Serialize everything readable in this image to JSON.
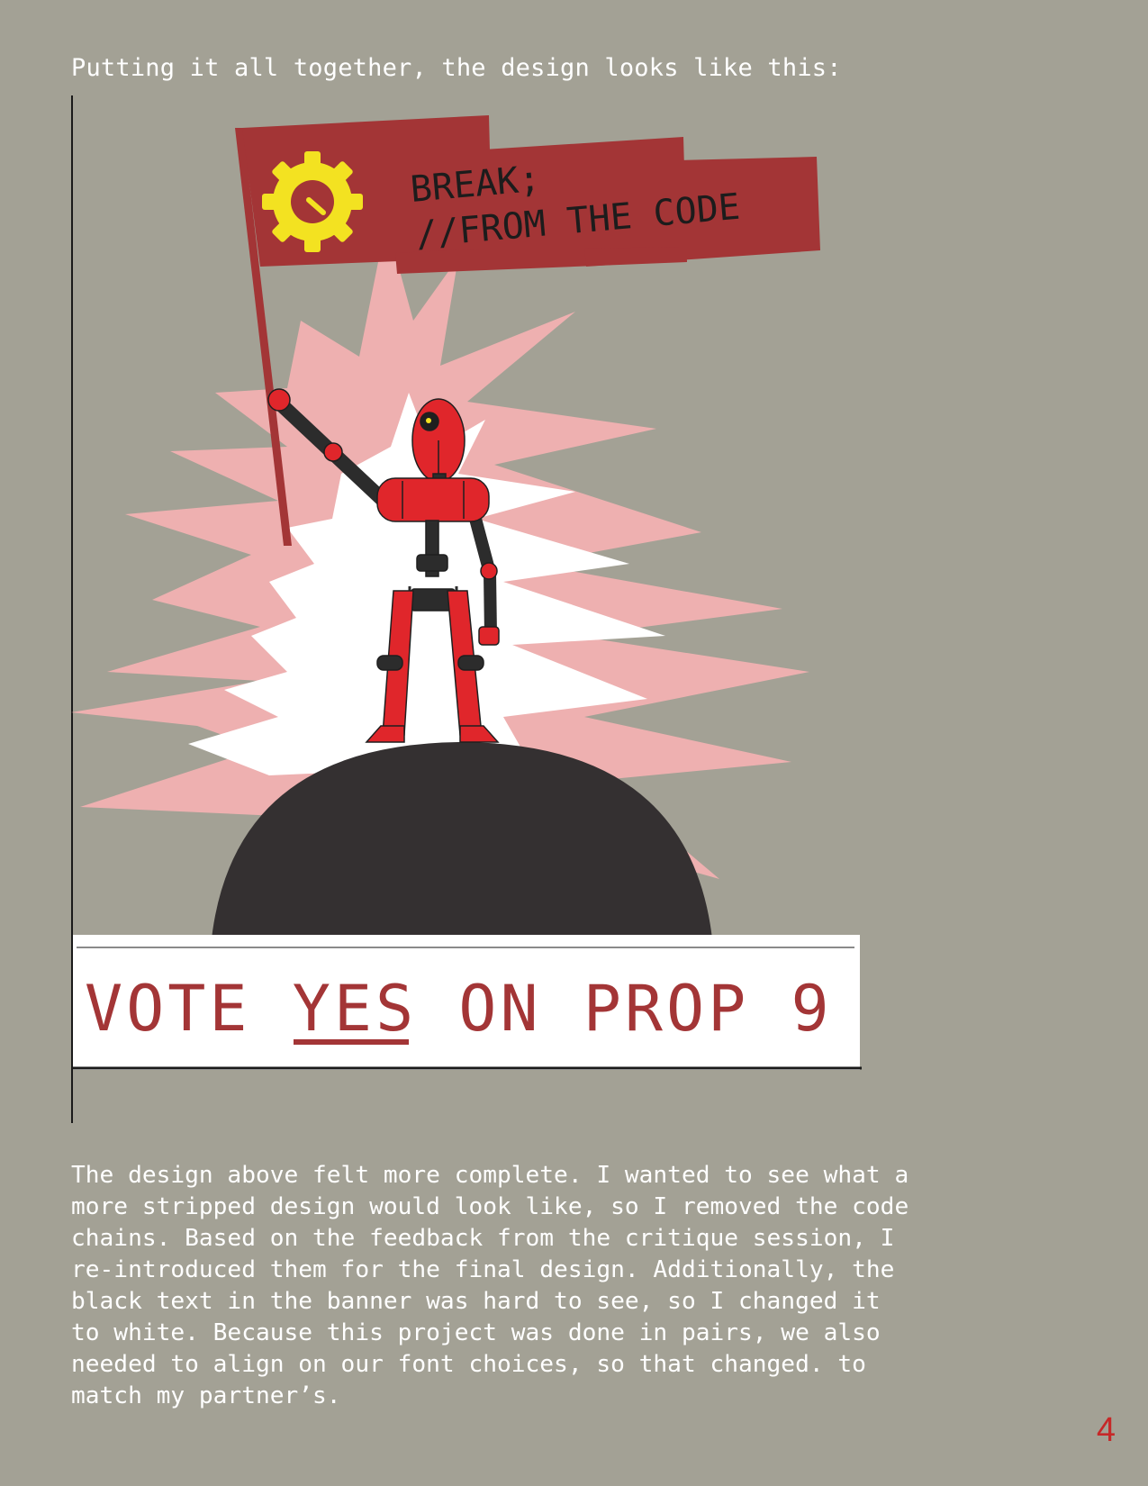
{
  "intro": "Putting it all together, the design looks like this:",
  "poster": {
    "flag_line1": "BREAK;",
    "flag_line2": "//FROM THE CODE",
    "vote_pre": "VOTE ",
    "vote_yes": "YES",
    "vote_post": " ON PROP 9",
    "colors": {
      "background": "#a3a195",
      "flag": "#a33536",
      "gear": "#f3e221",
      "robot": "#e0262b",
      "planet": "#343031",
      "burst": "#eeb0b0"
    }
  },
  "body": "The design above felt more complete. I wanted to see what a\nmore stripped design would look like, so I removed the code\nchains. Based on the feedback from the critique session, I\nre-introduced them for the final design. Additionally, the\nblack text in the banner was hard to see, so I changed it\nto white. Because this project was done in pairs, we also\nneeded to align on our font choices, so that changed. to\nmatch my partner’s.",
  "page_number": "4"
}
